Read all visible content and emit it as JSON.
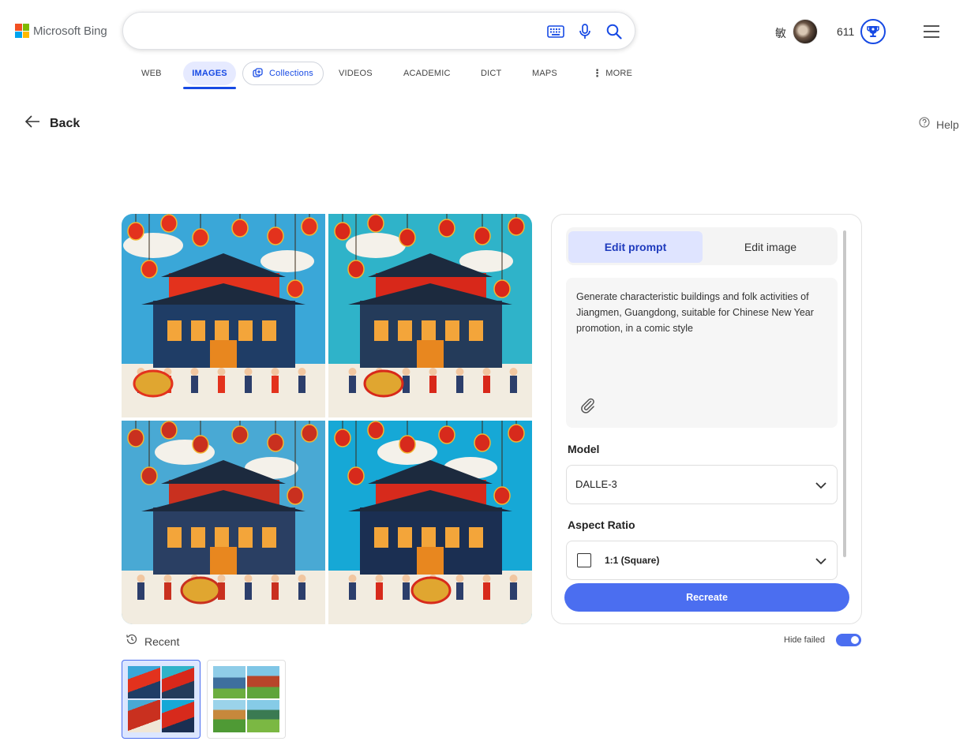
{
  "header": {
    "brand": "Microsoft Bing",
    "brand_colors": [
      "#f25022",
      "#7fba00",
      "#00a4ef",
      "#ffb900"
    ],
    "search_value": "",
    "user_name": "敏",
    "points": "611"
  },
  "nav": {
    "web": "WEB",
    "images": "IMAGES",
    "collections": "Collections",
    "videos": "VIDEOS",
    "academic": "ACADEMIC",
    "dict": "DICT",
    "maps": "MAPS",
    "more": "MORE",
    "active": "IMAGES"
  },
  "page": {
    "back_label": "Back",
    "help_label": "Help"
  },
  "results": {
    "images": [
      {
        "sky": "#3aa7d8",
        "main": "#e3321d",
        "accent": "#1f3d66"
      },
      {
        "sky": "#2fb3c9",
        "main": "#d8281a",
        "accent": "#243b5a"
      },
      {
        "sky": "#49a9d4",
        "main": "#c9301f",
        "accent": "#2a3f63"
      },
      {
        "sky": "#16a8d6",
        "main": "#d72a1c",
        "accent": "#1b2f52"
      }
    ]
  },
  "recent": {
    "label": "Recent",
    "hide_failed_label": "Hide failed",
    "hide_failed_on": true
  },
  "panel": {
    "tab_edit_prompt": "Edit prompt",
    "tab_edit_image": "Edit image",
    "active_tab": "Edit prompt",
    "prompt": "Generate characteristic buildings and folk activities of Jiangmen, Guangdong, suitable for Chinese New Year promotion, in a comic style",
    "model_label": "Model",
    "model_value": "DALLE-3",
    "aspect_label": "Aspect Ratio",
    "aspect_value": "1:1 (Square)",
    "recreate_label": "Recreate"
  },
  "colors": {
    "accent": "#174ae4",
    "button": "#4b6ef0",
    "tab_active_bg": "#dfe4ff"
  }
}
